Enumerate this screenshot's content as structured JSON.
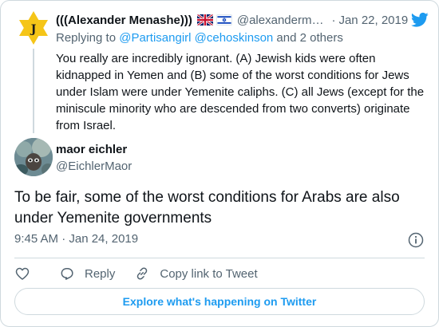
{
  "parent_tweet": {
    "name": "(((Alexander Menashe)))",
    "handle": "@alexanderm…",
    "separator": "·",
    "date": "Jan 22, 2019",
    "replying_prefix": "Replying to ",
    "replying_users": "@Partisangirl @cehoskinson",
    "replying_suffix": " and 2 others",
    "text": "You really are incredibly ignorant. (A) Jewish kids were often kidnapped in Yemen and (B) some of the worst conditions for Jews under Islam were under Yemenite caliphs. (C) all Jews (except for the miniscule minority who are descended from two converts) originate from Israel.",
    "avatar_letter": "J"
  },
  "main_tweet": {
    "name": "maor eichler",
    "handle": "@EichlerMaor",
    "text": "To be fair, some of the worst conditions for Arabs are also under Yemenite governments",
    "timestamp": "9:45 AM · Jan 24, 2019"
  },
  "actions": {
    "reply": "Reply",
    "copy_link": "Copy link to Tweet"
  },
  "explore_label": "Explore what's happening on Twitter",
  "colors": {
    "accent": "#1d9bf0",
    "secondary_text": "#536471",
    "border": "#cfd9de",
    "star": "#f5c518"
  },
  "icons": {
    "brand": "twitter-bird-icon",
    "like": "heart-icon",
    "reply": "comment-icon",
    "copy": "link-icon",
    "info": "info-icon"
  }
}
